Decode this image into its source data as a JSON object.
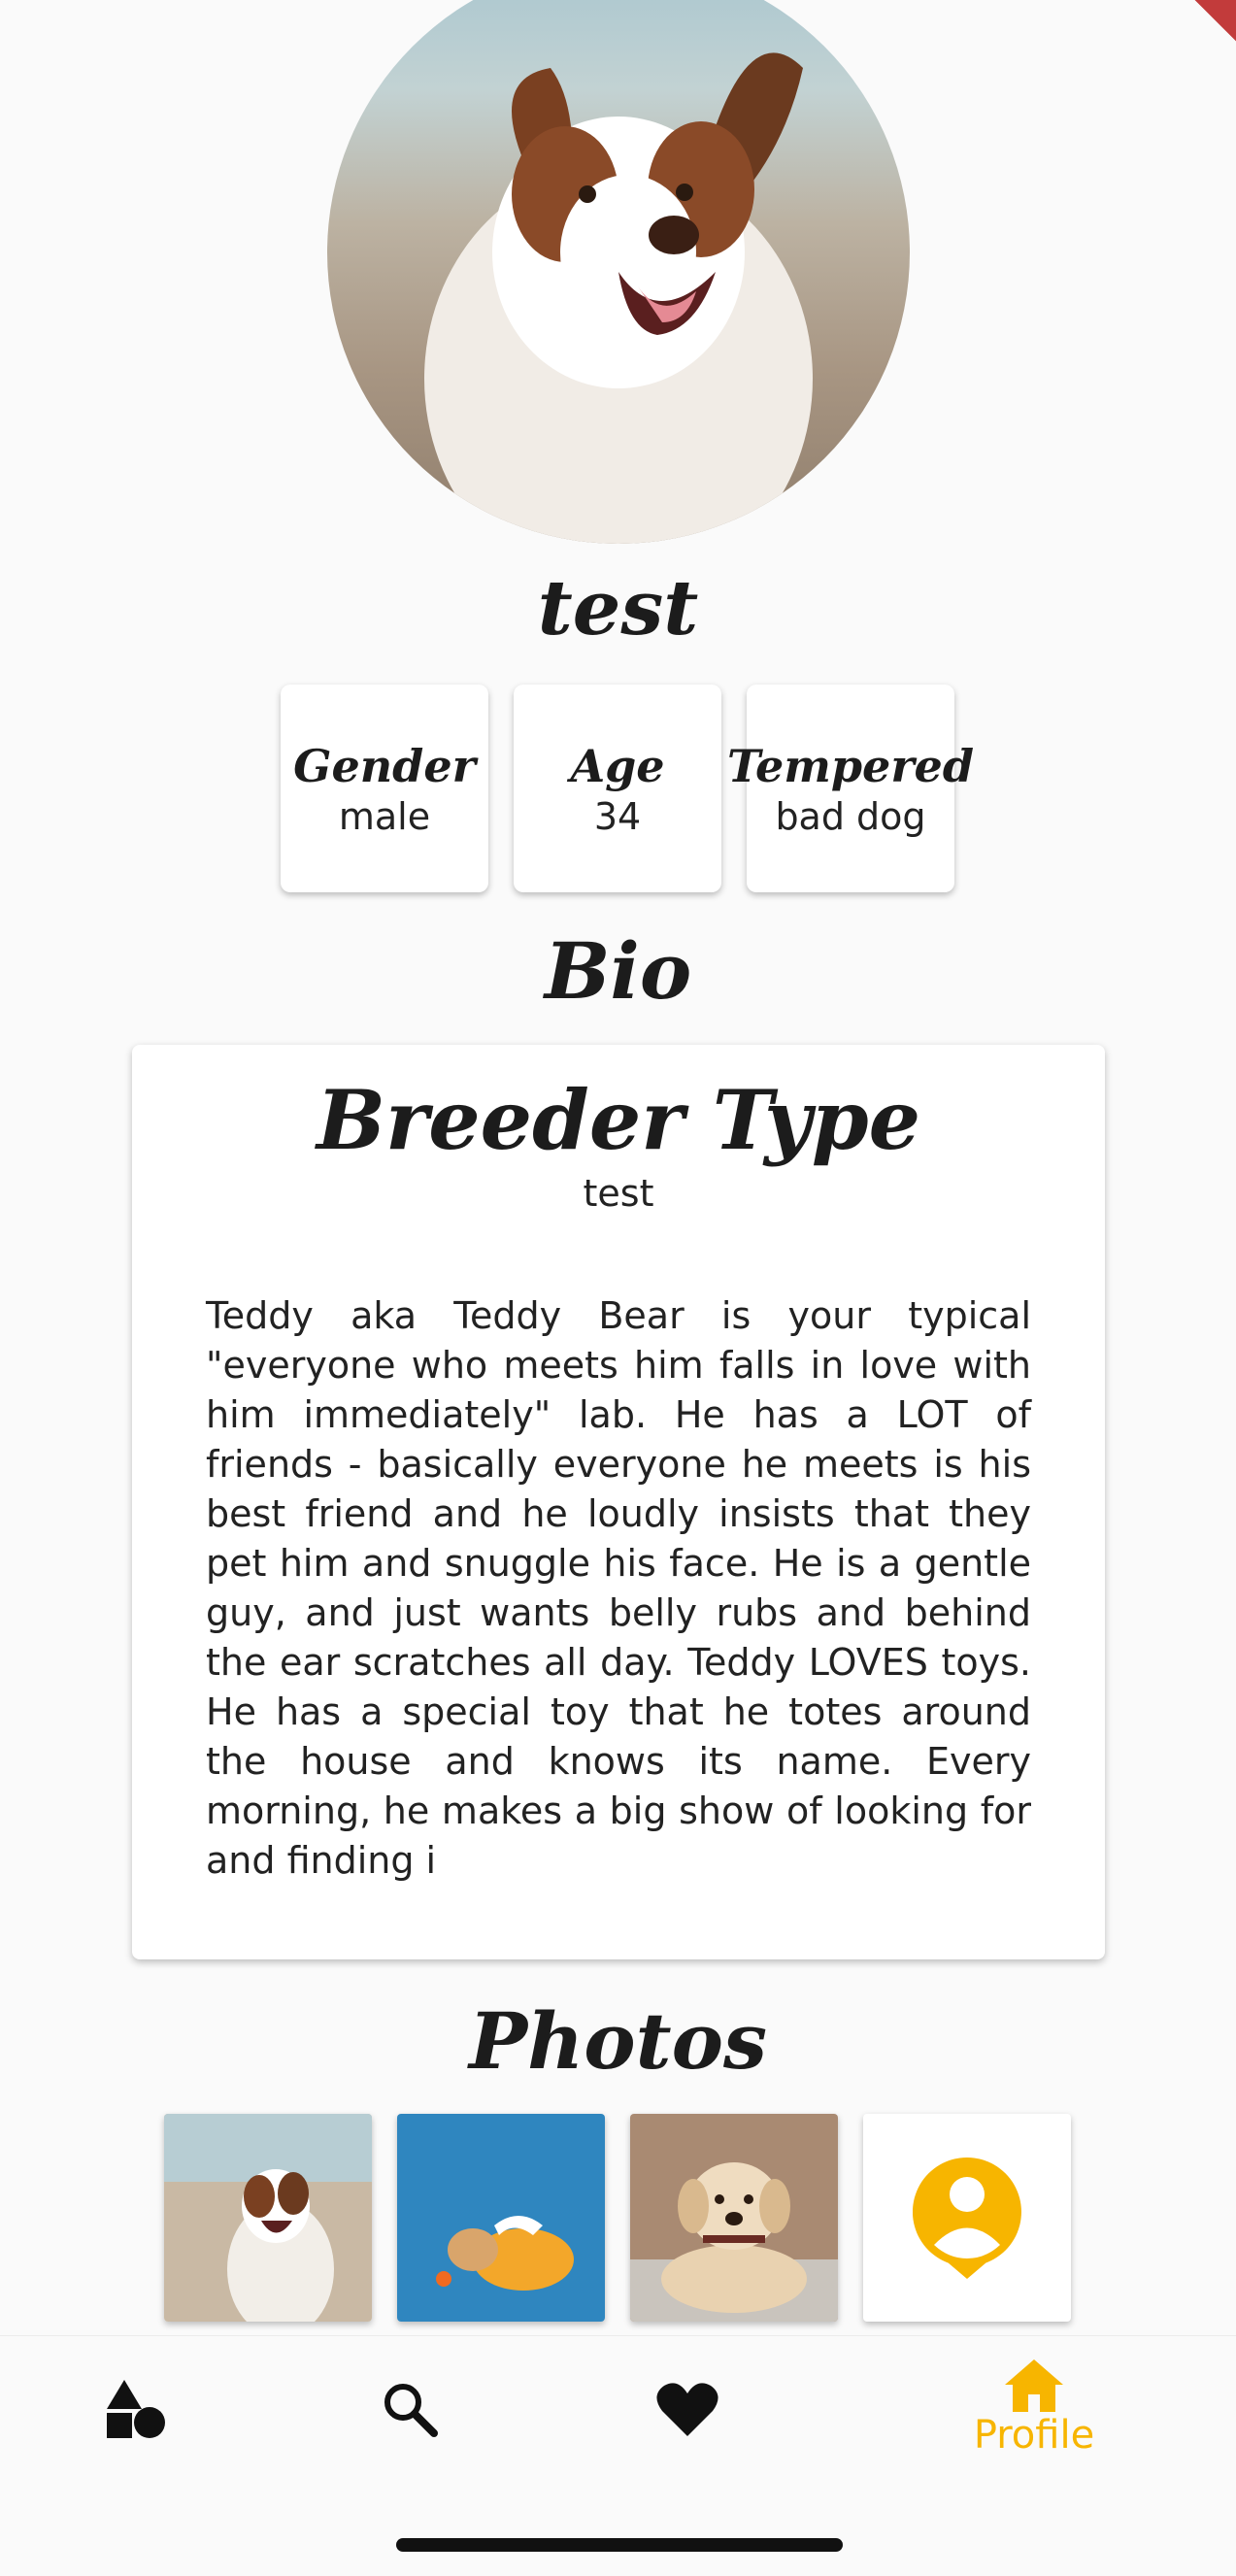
{
  "profile": {
    "name": "test",
    "stats": [
      {
        "title": "Gender",
        "value": "male"
      },
      {
        "title": "Age",
        "value": "34"
      },
      {
        "title": "Tempered",
        "value": "bad dog"
      }
    ]
  },
  "bio": {
    "heading": "Bio",
    "breeder_type_title": "Breeder Type",
    "breeder_type_value": "test",
    "text": "Teddy aka Teddy Bear is your typical \"everyone who meets him falls in love with him immediately\" lab. He has a LOT of friends - basically everyone he meets is his best friend and he loudly insists that they pet him and snuggle his face. He is a gentle guy, and just wants belly rubs and behind the ear scratches all day. Teddy LOVES toys. He has a special toy that he totes around the house and knows its name. Every morning, he makes a big show of looking for and finding i"
  },
  "photos": {
    "heading": "Photos"
  },
  "nav": {
    "items": [
      {
        "icon": "shapes-icon",
        "label": ""
      },
      {
        "icon": "search-icon",
        "label": ""
      },
      {
        "icon": "heart-icon",
        "label": ""
      },
      {
        "icon": "home-icon",
        "label": "Profile"
      }
    ],
    "active_color": "#f7b500",
    "inactive_color": "#111111"
  }
}
